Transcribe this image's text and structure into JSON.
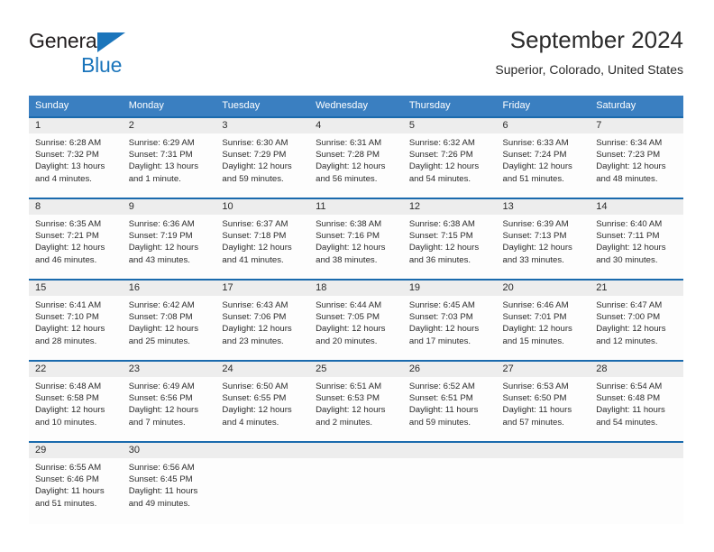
{
  "brand": {
    "line1": "General",
    "line2": "Blue",
    "triangle_icon": "brand-triangle-icon",
    "accent_color": "#1b75bb"
  },
  "title": {
    "month_year": "September 2024",
    "location": "Superior, Colorado, United States"
  },
  "colors": {
    "header_blue": "#3a7fc1",
    "separator_blue": "#1a6aad",
    "daynum_bg": "#ededed",
    "cell_bg": "#fdfdfd",
    "text": "#2b2b2b"
  },
  "weekday_headers": [
    "Sunday",
    "Monday",
    "Tuesday",
    "Wednesday",
    "Thursday",
    "Friday",
    "Saturday"
  ],
  "weeks": [
    [
      {
        "day": "1",
        "sunrise": "Sunrise: 6:28 AM",
        "sunset": "Sunset: 7:32 PM",
        "daylight": "Daylight: 13 hours and 4 minutes."
      },
      {
        "day": "2",
        "sunrise": "Sunrise: 6:29 AM",
        "sunset": "Sunset: 7:31 PM",
        "daylight": "Daylight: 13 hours and 1 minute."
      },
      {
        "day": "3",
        "sunrise": "Sunrise: 6:30 AM",
        "sunset": "Sunset: 7:29 PM",
        "daylight": "Daylight: 12 hours and 59 minutes."
      },
      {
        "day": "4",
        "sunrise": "Sunrise: 6:31 AM",
        "sunset": "Sunset: 7:28 PM",
        "daylight": "Daylight: 12 hours and 56 minutes."
      },
      {
        "day": "5",
        "sunrise": "Sunrise: 6:32 AM",
        "sunset": "Sunset: 7:26 PM",
        "daylight": "Daylight: 12 hours and 54 minutes."
      },
      {
        "day": "6",
        "sunrise": "Sunrise: 6:33 AM",
        "sunset": "Sunset: 7:24 PM",
        "daylight": "Daylight: 12 hours and 51 minutes."
      },
      {
        "day": "7",
        "sunrise": "Sunrise: 6:34 AM",
        "sunset": "Sunset: 7:23 PM",
        "daylight": "Daylight: 12 hours and 48 minutes."
      }
    ],
    [
      {
        "day": "8",
        "sunrise": "Sunrise: 6:35 AM",
        "sunset": "Sunset: 7:21 PM",
        "daylight": "Daylight: 12 hours and 46 minutes."
      },
      {
        "day": "9",
        "sunrise": "Sunrise: 6:36 AM",
        "sunset": "Sunset: 7:19 PM",
        "daylight": "Daylight: 12 hours and 43 minutes."
      },
      {
        "day": "10",
        "sunrise": "Sunrise: 6:37 AM",
        "sunset": "Sunset: 7:18 PM",
        "daylight": "Daylight: 12 hours and 41 minutes."
      },
      {
        "day": "11",
        "sunrise": "Sunrise: 6:38 AM",
        "sunset": "Sunset: 7:16 PM",
        "daylight": "Daylight: 12 hours and 38 minutes."
      },
      {
        "day": "12",
        "sunrise": "Sunrise: 6:38 AM",
        "sunset": "Sunset: 7:15 PM",
        "daylight": "Daylight: 12 hours and 36 minutes."
      },
      {
        "day": "13",
        "sunrise": "Sunrise: 6:39 AM",
        "sunset": "Sunset: 7:13 PM",
        "daylight": "Daylight: 12 hours and 33 minutes."
      },
      {
        "day": "14",
        "sunrise": "Sunrise: 6:40 AM",
        "sunset": "Sunset: 7:11 PM",
        "daylight": "Daylight: 12 hours and 30 minutes."
      }
    ],
    [
      {
        "day": "15",
        "sunrise": "Sunrise: 6:41 AM",
        "sunset": "Sunset: 7:10 PM",
        "daylight": "Daylight: 12 hours and 28 minutes."
      },
      {
        "day": "16",
        "sunrise": "Sunrise: 6:42 AM",
        "sunset": "Sunset: 7:08 PM",
        "daylight": "Daylight: 12 hours and 25 minutes."
      },
      {
        "day": "17",
        "sunrise": "Sunrise: 6:43 AM",
        "sunset": "Sunset: 7:06 PM",
        "daylight": "Daylight: 12 hours and 23 minutes."
      },
      {
        "day": "18",
        "sunrise": "Sunrise: 6:44 AM",
        "sunset": "Sunset: 7:05 PM",
        "daylight": "Daylight: 12 hours and 20 minutes."
      },
      {
        "day": "19",
        "sunrise": "Sunrise: 6:45 AM",
        "sunset": "Sunset: 7:03 PM",
        "daylight": "Daylight: 12 hours and 17 minutes."
      },
      {
        "day": "20",
        "sunrise": "Sunrise: 6:46 AM",
        "sunset": "Sunset: 7:01 PM",
        "daylight": "Daylight: 12 hours and 15 minutes."
      },
      {
        "day": "21",
        "sunrise": "Sunrise: 6:47 AM",
        "sunset": "Sunset: 7:00 PM",
        "daylight": "Daylight: 12 hours and 12 minutes."
      }
    ],
    [
      {
        "day": "22",
        "sunrise": "Sunrise: 6:48 AM",
        "sunset": "Sunset: 6:58 PM",
        "daylight": "Daylight: 12 hours and 10 minutes."
      },
      {
        "day": "23",
        "sunrise": "Sunrise: 6:49 AM",
        "sunset": "Sunset: 6:56 PM",
        "daylight": "Daylight: 12 hours and 7 minutes."
      },
      {
        "day": "24",
        "sunrise": "Sunrise: 6:50 AM",
        "sunset": "Sunset: 6:55 PM",
        "daylight": "Daylight: 12 hours and 4 minutes."
      },
      {
        "day": "25",
        "sunrise": "Sunrise: 6:51 AM",
        "sunset": "Sunset: 6:53 PM",
        "daylight": "Daylight: 12 hours and 2 minutes."
      },
      {
        "day": "26",
        "sunrise": "Sunrise: 6:52 AM",
        "sunset": "Sunset: 6:51 PM",
        "daylight": "Daylight: 11 hours and 59 minutes."
      },
      {
        "day": "27",
        "sunrise": "Sunrise: 6:53 AM",
        "sunset": "Sunset: 6:50 PM",
        "daylight": "Daylight: 11 hours and 57 minutes."
      },
      {
        "day": "28",
        "sunrise": "Sunrise: 6:54 AM",
        "sunset": "Sunset: 6:48 PM",
        "daylight": "Daylight: 11 hours and 54 minutes."
      }
    ],
    [
      {
        "day": "29",
        "sunrise": "Sunrise: 6:55 AM",
        "sunset": "Sunset: 6:46 PM",
        "daylight": "Daylight: 11 hours and 51 minutes."
      },
      {
        "day": "30",
        "sunrise": "Sunrise: 6:56 AM",
        "sunset": "Sunset: 6:45 PM",
        "daylight": "Daylight: 11 hours and 49 minutes."
      },
      {
        "day": "",
        "sunrise": "",
        "sunset": "",
        "daylight": ""
      },
      {
        "day": "",
        "sunrise": "",
        "sunset": "",
        "daylight": ""
      },
      {
        "day": "",
        "sunrise": "",
        "sunset": "",
        "daylight": ""
      },
      {
        "day": "",
        "sunrise": "",
        "sunset": "",
        "daylight": ""
      },
      {
        "day": "",
        "sunrise": "",
        "sunset": "",
        "daylight": ""
      }
    ]
  ]
}
